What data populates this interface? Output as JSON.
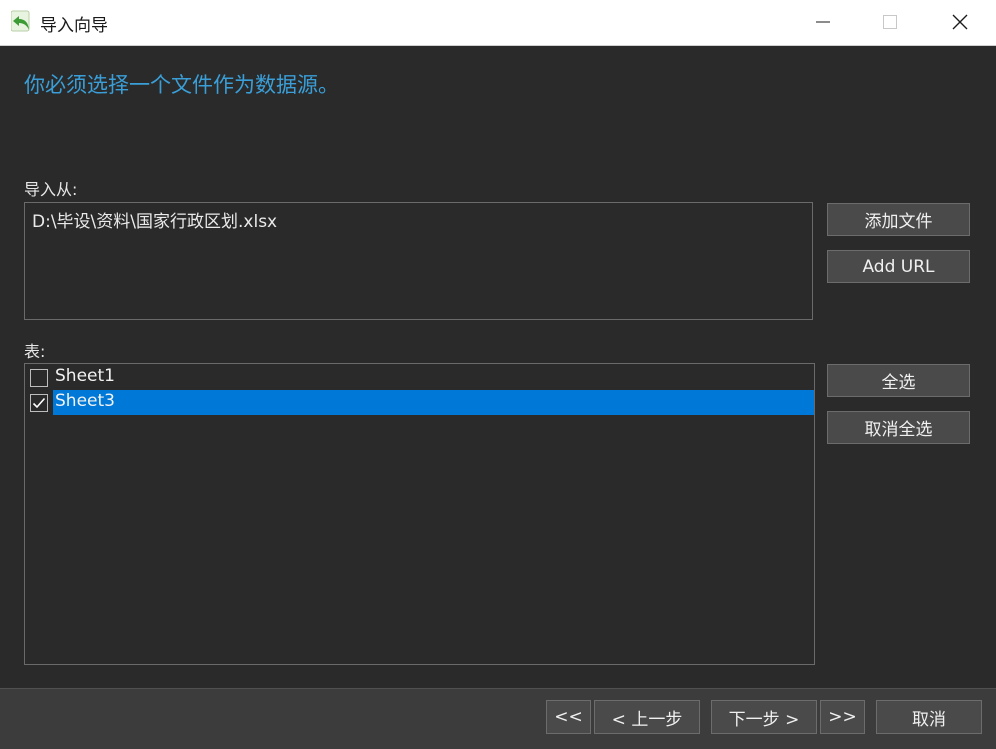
{
  "window": {
    "title": "导入向导",
    "icon": "import-arrow-icon"
  },
  "instruction": "你必须选择一个文件作为数据源。",
  "source": {
    "label": "导入从:",
    "path": "D:\\毕设\\资料\\国家行政区划.xlsx",
    "add_file_label": "添加文件",
    "add_url_label": "Add URL"
  },
  "tables": {
    "label": "表:",
    "items": [
      {
        "name": "Sheet1",
        "checked": false,
        "selected": false
      },
      {
        "name": "Sheet3",
        "checked": true,
        "selected": true
      }
    ],
    "select_all_label": "全选",
    "deselect_all_label": "取消全选"
  },
  "footer": {
    "first_label": "<<",
    "prev_label": "< 上一步",
    "next_label": "下一步 >",
    "last_label": ">>",
    "cancel_label": "取消"
  },
  "colors": {
    "accent": "#0078d7",
    "instruction_text": "#3a9fd8",
    "background": "#2a2a2a"
  }
}
